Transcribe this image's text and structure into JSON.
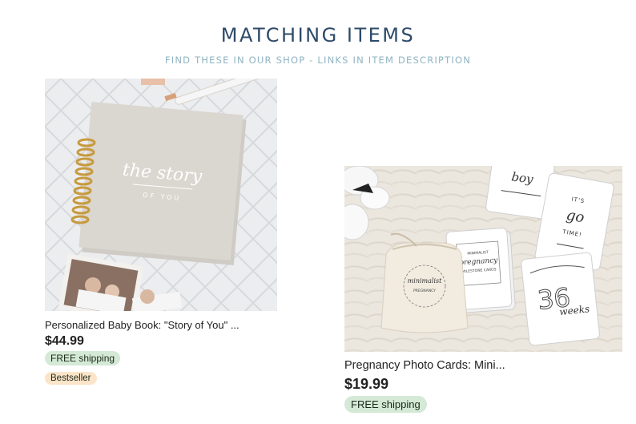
{
  "header": {
    "title": "MATCHING ITEMS",
    "subtitle": "FIND THESE IN OUR SHOP - LINKS IN ITEM DESCRIPTION"
  },
  "items": [
    {
      "title": "Personalized Baby Book: \"Story of You\" ...",
      "price": "$44.99",
      "shipping": "FREE shipping",
      "badge": "Bestseller",
      "image_text": {
        "cover_line1": "the story",
        "cover_line2": "OF YOU"
      }
    },
    {
      "title": "Pregnancy Photo Cards: Mini...",
      "price": "$19.99",
      "shipping": "FREE shipping",
      "image_text": {
        "card_boy": "boy",
        "card_time_1": "IT'S",
        "card_time_2": "go",
        "card_time_3": "TIME!",
        "card_week_num": "36",
        "card_week_word": "weeks",
        "card_front_1": "MINIMALIST",
        "card_front_2": "pregnancy",
        "card_front_3": "MILESTONE CARDS",
        "bag_1": "minimalist",
        "bag_2": "PREGNANCY"
      }
    }
  ],
  "colors": {
    "title": "#2e4a68",
    "subtitle": "#8fb4c2",
    "shipping_badge": "#d4e9d6",
    "bestseller_badge": "#fbe4c8"
  }
}
